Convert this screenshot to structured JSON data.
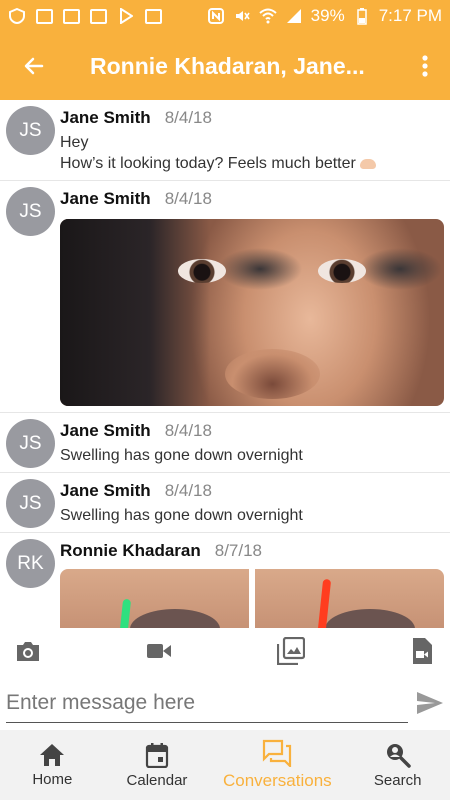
{
  "status_bar": {
    "battery": "39%",
    "time": "7:17 PM"
  },
  "app_bar": {
    "title": "Ronnie Khadaran, Jane..."
  },
  "messages": [
    {
      "initials": "JS",
      "sender": "Jane Smith",
      "date": "8/4/18",
      "lines": [
        "Hey",
        "How’s it looking today? Feels much better"
      ],
      "emoji": "flexed-biceps"
    },
    {
      "initials": "JS",
      "sender": "Jane Smith",
      "date": "8/4/18",
      "attachment": "photo"
    },
    {
      "initials": "JS",
      "sender": "Jane Smith",
      "date": "8/4/18",
      "text": "Swelling has gone down overnight"
    },
    {
      "initials": "JS",
      "sender": "Jane Smith",
      "date": "8/4/18",
      "text": "Swelling has gone down overnight"
    },
    {
      "initials": "RK",
      "sender": "Ronnie Khadaran",
      "date": "8/7/18",
      "attachment": "photo"
    }
  ],
  "composer": {
    "placeholder": "Enter message here"
  },
  "attachments": [
    "camera-icon",
    "video-icon",
    "gallery-icon",
    "file-video-icon"
  ],
  "nav": {
    "home": "Home",
    "calendar": "Calendar",
    "conversations": "Conversations",
    "search": "Search"
  },
  "colors": {
    "accent": "#f9b13d",
    "avatar": "#999aa0"
  }
}
